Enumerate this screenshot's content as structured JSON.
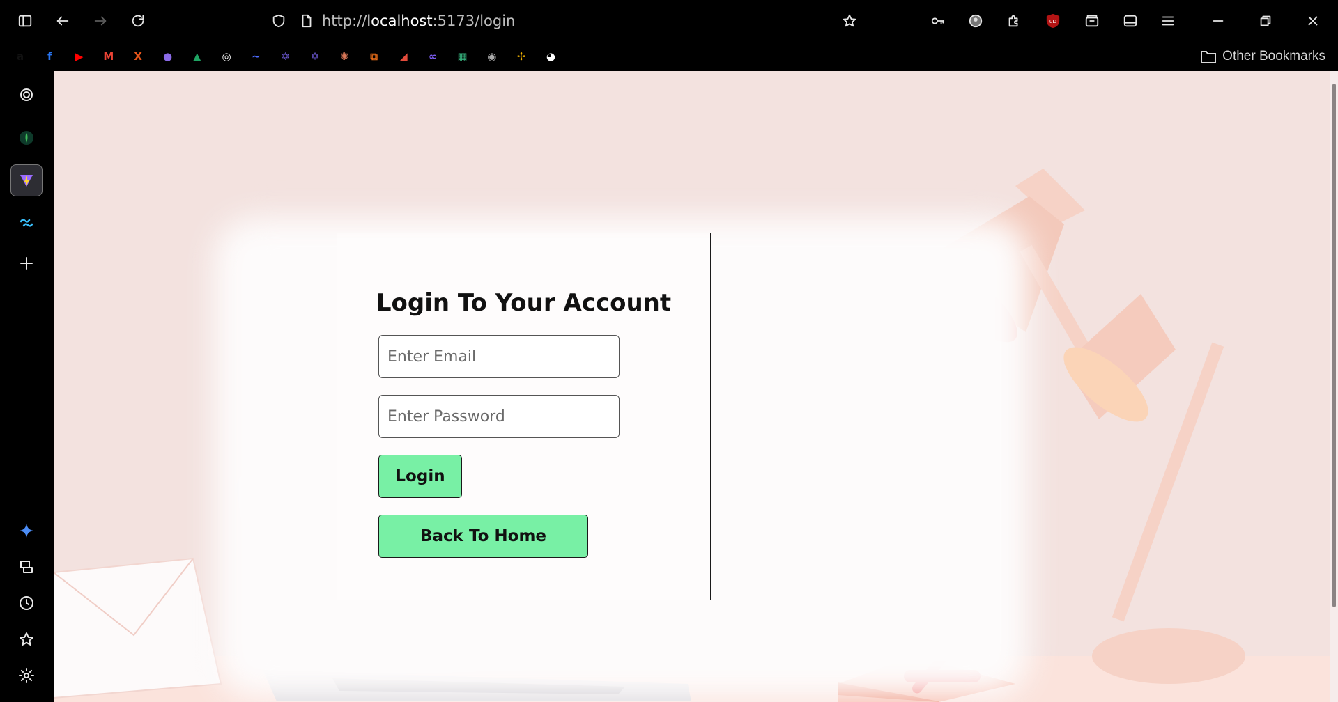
{
  "browser": {
    "url_scheme": "http://",
    "url_host": "localhost",
    "url_rest": ":5173/login",
    "other_bookmarks_label": "Other Bookmarks",
    "bookmarks": [
      {
        "icon": "amazon-icon",
        "glyph": "a",
        "color": "#111"
      },
      {
        "icon": "flipkart-icon",
        "glyph": "f",
        "color": "#2874f0"
      },
      {
        "icon": "youtube-icon",
        "glyph": "▶",
        "color": "#ff0000"
      },
      {
        "icon": "gmail-icon",
        "glyph": "M",
        "color": "#ea4335"
      },
      {
        "icon": "x-icon",
        "glyph": "X",
        "color": "#e8551a"
      },
      {
        "icon": "orb-icon",
        "glyph": "●",
        "color": "#8b6be8"
      },
      {
        "icon": "google-drive-icon",
        "glyph": "▲",
        "color": "#1fa463"
      },
      {
        "icon": "chatgpt-icon",
        "glyph": "◎",
        "color": "#ffffff"
      },
      {
        "icon": "deepseek-icon",
        "glyph": "~",
        "color": "#4d6bfe"
      },
      {
        "icon": "star-app-icon",
        "glyph": "✡",
        "color": "#6f5bd8"
      },
      {
        "icon": "star-app-2-icon",
        "glyph": "✡",
        "color": "#6f5bd8"
      },
      {
        "icon": "claude-icon",
        "glyph": "✺",
        "color": "#d97757"
      },
      {
        "icon": "bolt-icon",
        "glyph": "⧉",
        "color": "#f0701a"
      },
      {
        "icon": "play-app-icon",
        "glyph": "◢",
        "color": "#e24b3b"
      },
      {
        "icon": "infinity-icon",
        "glyph": "∞",
        "color": "#7b5cf0"
      },
      {
        "icon": "jira-app-icon",
        "glyph": "▦",
        "color": "#36b37e"
      },
      {
        "icon": "github-icon",
        "glyph": "◉",
        "color": "#aaaaaa"
      },
      {
        "icon": "pinwheel-icon",
        "glyph": "✢",
        "color": "#f4b400"
      },
      {
        "icon": "incognito-icon",
        "glyph": "◕",
        "color": "#ffffff"
      }
    ]
  },
  "sidebar": {
    "items": [
      {
        "icon": "chatgpt-icon"
      },
      {
        "icon": "mongodb-icon"
      },
      {
        "icon": "vite-icon"
      },
      {
        "icon": "tailwind-icon"
      },
      {
        "icon": "add-icon"
      }
    ],
    "bottom_items": [
      {
        "icon": "gemini-icon"
      },
      {
        "icon": "synced-tabs-icon"
      },
      {
        "icon": "history-icon"
      },
      {
        "icon": "bookmarks-star-icon"
      },
      {
        "icon": "settings-icon"
      }
    ]
  },
  "login": {
    "title": "Login To Your Account",
    "email_placeholder": "Enter Email",
    "password_placeholder": "Enter Password",
    "login_label": "Login",
    "home_label": "Back To Home"
  },
  "colors": {
    "button_green": "#78f0a5",
    "page_background": "#f3e2df"
  }
}
